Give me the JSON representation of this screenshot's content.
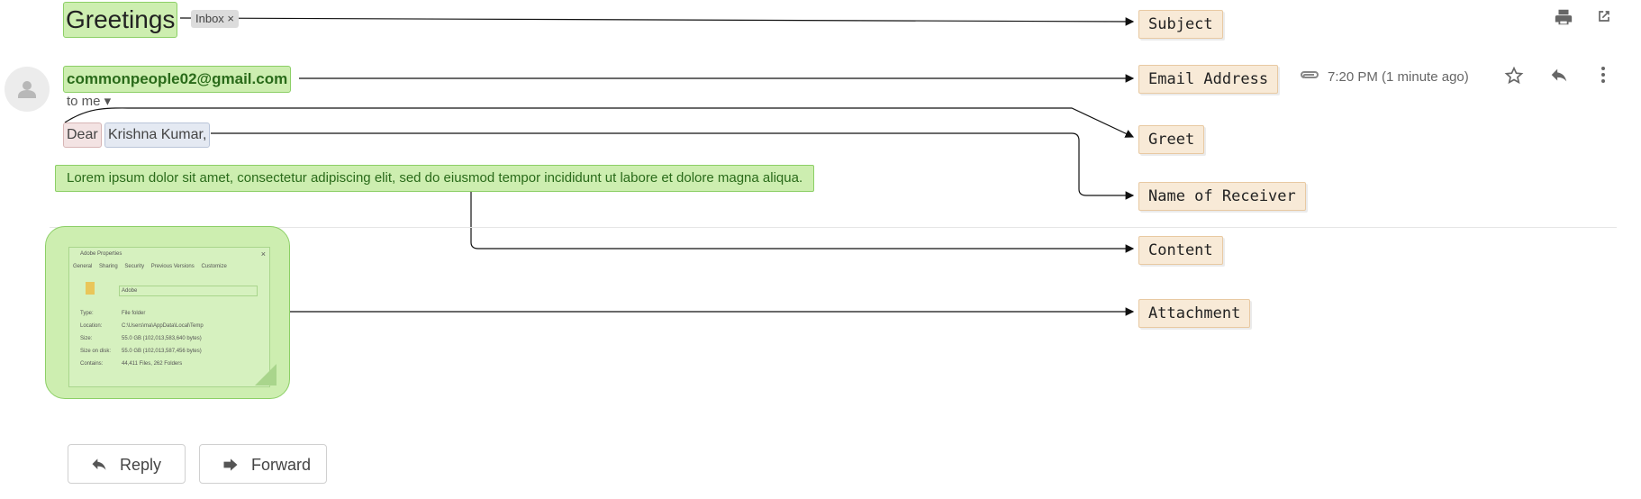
{
  "email": {
    "subject": "Greetings",
    "inbox_chip": "Inbox ×",
    "sender": "commonpeople02@gmail.com",
    "to": "to me ▾",
    "greeting": "Dear",
    "receiver": "Krishna Kumar,",
    "body": "Lorem ipsum dolor sit amet, consectetur adipiscing elit, sed do eiusmod tempor incididunt ut labore et dolore magna aliqua.",
    "time": "7:20 PM (1 minute ago)"
  },
  "attachment_preview": {
    "title": "Adobe Properties",
    "tabs": [
      "General",
      "Sharing",
      "Security",
      "Previous Versions",
      "Customize"
    ],
    "name": "Adobe",
    "rows": [
      {
        "k": "Type:",
        "v": "File folder"
      },
      {
        "k": "Location:",
        "v": "C:\\Users\\ma\\AppData\\Local\\Temp"
      },
      {
        "k": "Size:",
        "v": "55.0 GB (102,013,583,640 bytes)"
      },
      {
        "k": "Size on disk:",
        "v": "55.0 GB (102,013,587,456 bytes)"
      },
      {
        "k": "Contains:",
        "v": "44,411 Files, 262 Folders"
      }
    ]
  },
  "actions": {
    "reply": "Reply",
    "forward": "Forward"
  },
  "annotations": {
    "subject": "Subject",
    "email_address": "Email Address",
    "greet": "Greet",
    "name_of_receiver": "Name of Receiver",
    "content": "Content",
    "attachment": "Attachment"
  },
  "icons": {
    "print": "print-icon",
    "open_new": "open-in-new-icon",
    "attach": "paperclip-icon",
    "star": "star-icon",
    "reply": "reply-icon",
    "more": "more-vert-icon",
    "avatar": "avatar-icon"
  },
  "colors": {
    "highlight_green": "#cdeeb0",
    "highlight_pink": "#f3e3e3",
    "highlight_blue": "#e4e9f2",
    "annotation_fill": "#f8ead7"
  }
}
